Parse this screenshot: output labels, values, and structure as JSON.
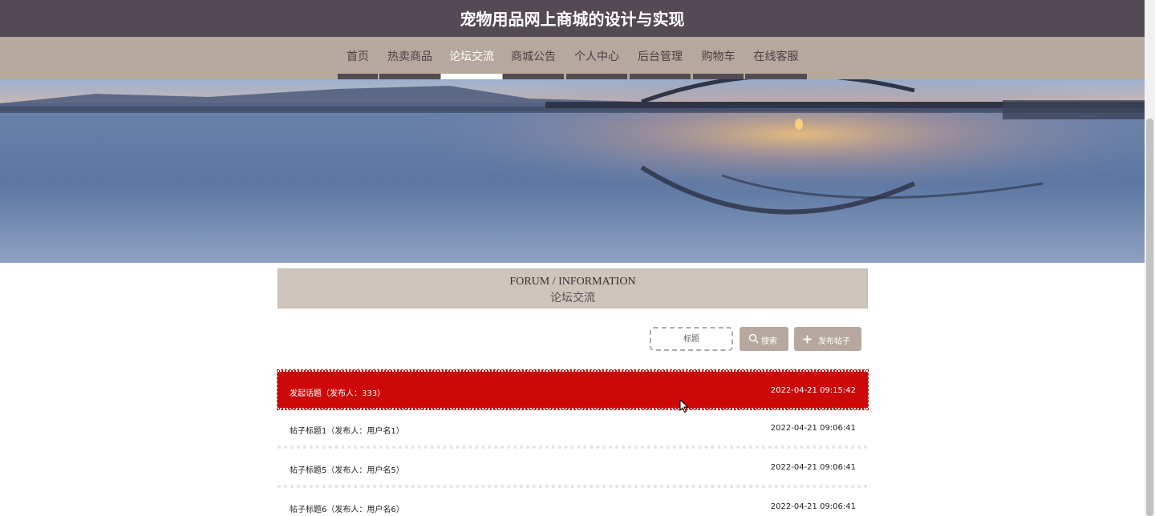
{
  "header": {
    "title": "宠物用品网上商城的设计与实现"
  },
  "nav": {
    "items": [
      {
        "label": "首页",
        "active": false
      },
      {
        "label": "热卖商品",
        "active": false
      },
      {
        "label": "论坛交流",
        "active": true
      },
      {
        "label": "商城公告",
        "active": false
      },
      {
        "label": "个人中心",
        "active": false
      },
      {
        "label": "后台管理",
        "active": false
      },
      {
        "label": "购物车",
        "active": false
      },
      {
        "label": "在线客服",
        "active": false
      }
    ]
  },
  "banner": {
    "slides": 3,
    "active_slide": 1
  },
  "section": {
    "title_en": "FORUM / INFORMATION",
    "title_zh": "论坛交流"
  },
  "search": {
    "placeholder": "标题",
    "search_label": "搜索",
    "search_icon": "search-icon",
    "publish_label": "发布帖子",
    "publish_icon": "plus-icon"
  },
  "posts": [
    {
      "title": "发起话题（发布人：333）",
      "time": "2022-04-21 09:15:42"
    },
    {
      "title": "帖子标题1（发布人：用户名1）",
      "time": "2022-04-21 09:06:41"
    },
    {
      "title": "帖子标题5（发布人：用户名5）",
      "time": "2022-04-21 09:06:41"
    },
    {
      "title": "帖子标题6（发布人：用户名6）",
      "time": "2022-04-21 09:06:41"
    }
  ],
  "colors": {
    "header_bg": "#544a53",
    "nav_bg": "#b6a89e",
    "section_bg": "#cdc4bc",
    "highlight_row": "#cd0808"
  }
}
